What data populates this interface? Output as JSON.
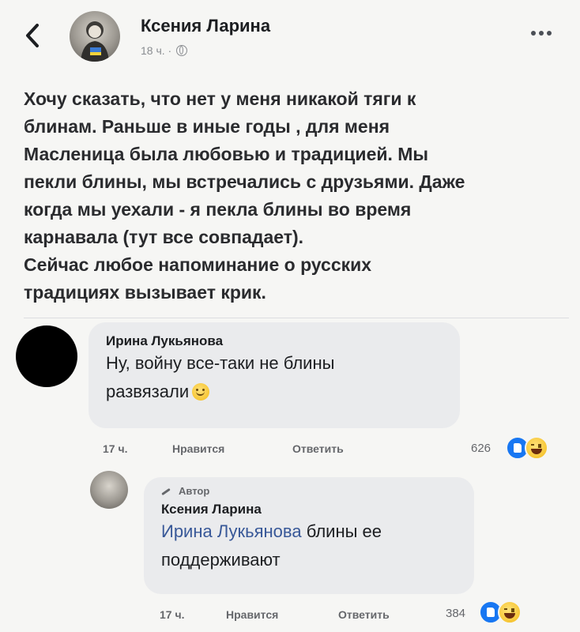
{
  "header": {
    "back_icon": "chevron-left-icon",
    "author": "Ксения Ларина",
    "time": "18 ч. ·",
    "privacy_icon": "globe-icon",
    "more_icon": "more-horizontal-icon"
  },
  "post": {
    "text": "Хочу сказать, что нет у меня никакой тяги к\nблинам. Раньше в иные годы , для меня\nМасленица была любовью и традицией.  Мы\nпекли блины, мы встречались с друзьями. Даже\nкогда мы уехали - я пекла блины во время\nкарнавала (тут все совпадает).\nСейчас любое напоминание о русских\nтрадициях вызывает крик."
  },
  "comments": [
    {
      "name": "Ирина Лукьянова",
      "text_line1": "Ну, войну все-таки не блины",
      "text_line2": "развязали",
      "emoji_icon": "smile-emoji-icon",
      "time": "17 ч.",
      "like_label": "Нравится",
      "reply_label": "Ответить",
      "reactions_count": "626",
      "reaction_icons": [
        "like-reaction-icon",
        "haha-reaction-icon"
      ]
    },
    {
      "author_tag": "Автор",
      "name": "Ксения Ларина",
      "mention": "Ирина Лукьянова",
      "text_rest": " блины ее",
      "text_line2": "поддерживают",
      "time": "17 ч.",
      "like_label": "Нравится",
      "reply_label": "Ответить",
      "reactions_count": "384",
      "reaction_icons": [
        "like-reaction-icon",
        "haha-reaction-icon"
      ]
    }
  ],
  "colors": {
    "background": "#f6f6f4",
    "bubble": "#eaebed",
    "mention": "#385898",
    "like_blue": "#1877f2",
    "secondary_text": "#65676b"
  }
}
